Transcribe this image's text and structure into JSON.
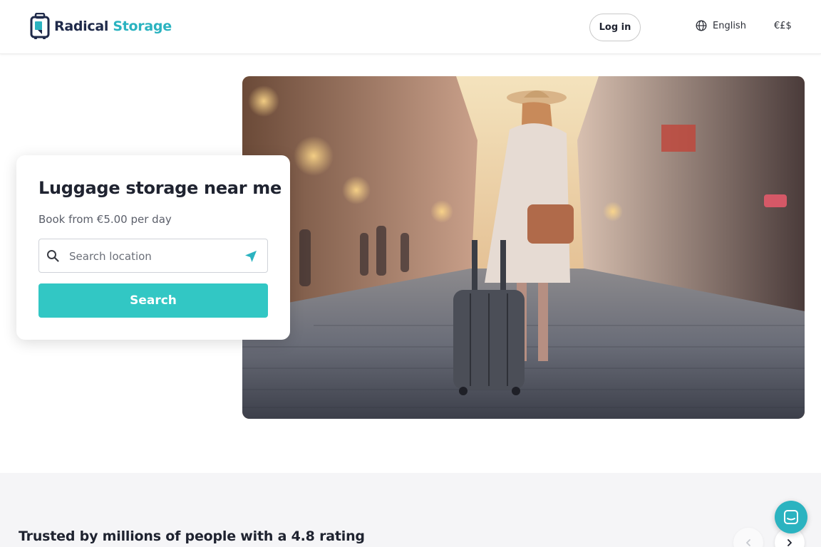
{
  "header": {
    "logo_part1": "Radical",
    "logo_part2": "Storage",
    "login_label": "Log in",
    "language_label": "English",
    "currency_label": "€£$"
  },
  "hero": {
    "image_description": "",
    "title": "Luggage storage near me",
    "subtitle": "Book from €5.00 per day",
    "search_placeholder": "Search location",
    "search_value": "",
    "search_button_label": "Search"
  },
  "trust": {
    "heading": "Trusted by millions of people with a 4.8 rating"
  },
  "colors": {
    "accent": "#32c7c4",
    "brand_dark": "#1f2a4a",
    "brand_teal": "#2bb3c0"
  },
  "icons": [
    "search-icon",
    "navigation-arrow-icon",
    "globe-icon",
    "chevron-left-icon",
    "chevron-right-icon",
    "chat-icon",
    "luggage-logo-icon"
  ]
}
